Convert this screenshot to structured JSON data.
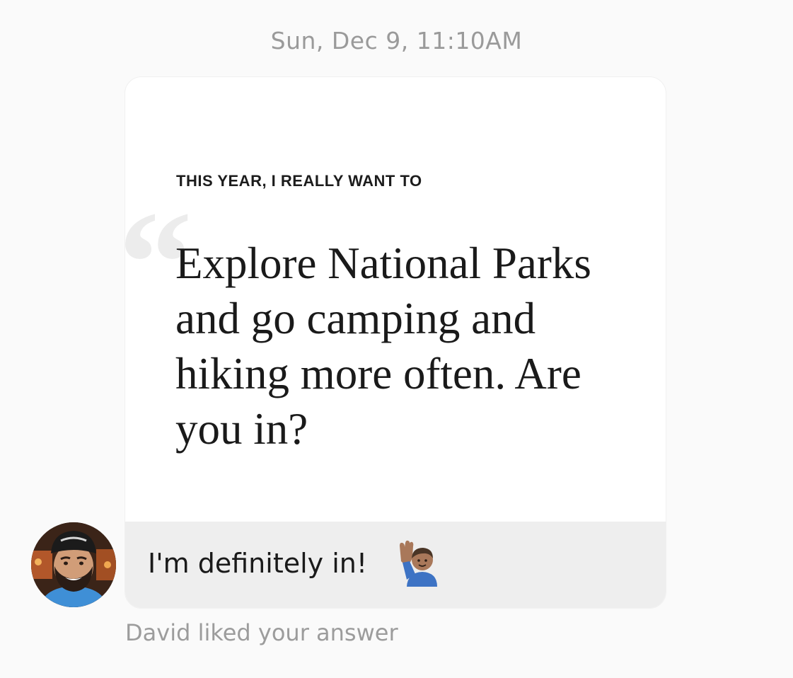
{
  "timestamp": "Sun, Dec 9, 11:10AM",
  "prompt": {
    "label": "THIS YEAR, I REALLY WANT TO",
    "quote_icon": "open-quote-icon",
    "answer": "Explore National Parks and go camping and hiking more often. Are you in?"
  },
  "reply": {
    "text": "I'm definitely in!",
    "emoji": "person-raising-hand-emoji"
  },
  "avatar": {
    "icon": "profile-photo"
  },
  "status": {
    "liked_text": "David liked your answer"
  },
  "colors": {
    "background": "#fafafa",
    "card": "#ffffff",
    "reply_bar": "#eeeeee",
    "muted_text": "#9a9a9a",
    "primary_text": "#1a1a1a"
  }
}
